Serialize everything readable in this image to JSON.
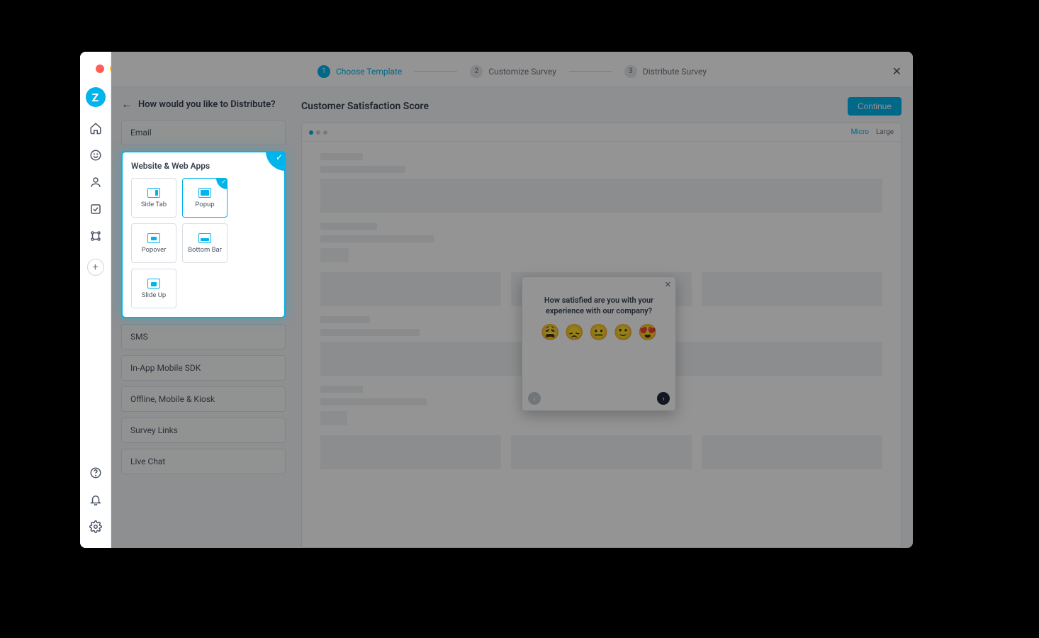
{
  "stepper": {
    "step1": {
      "num": "1",
      "label": "Choose Template"
    },
    "step2": {
      "num": "2",
      "label": "Customize Survey"
    },
    "step3": {
      "num": "3",
      "label": "Distribute Survey"
    }
  },
  "left": {
    "title": "How would you like to Distribute?",
    "channels": {
      "email": "Email",
      "web": "Website & Web Apps",
      "sms": "SMS",
      "sdk": "In-App Mobile SDK",
      "kiosk": "Offline, Mobile & Kiosk",
      "links": "Survey Links",
      "chat": "Live Chat"
    },
    "tiles": {
      "sidetab": "Side Tab",
      "popup": "Popup",
      "popover": "Popover",
      "bottombar": "Bottom Bar",
      "slideup": "Slide Up"
    }
  },
  "right": {
    "title": "Customer Satisfaction Score",
    "continue": "Continue",
    "sizes": {
      "micro": "Micro",
      "large": "Large"
    }
  },
  "popup": {
    "question": "How satisfied are you with your experience with our company?",
    "emojis": {
      "e1": "😩",
      "e2": "😞",
      "e3": "😐",
      "e4": "🙂",
      "e5": "😍"
    },
    "close": "✕",
    "prev": "‹",
    "next": "›"
  },
  "logo": "Z"
}
